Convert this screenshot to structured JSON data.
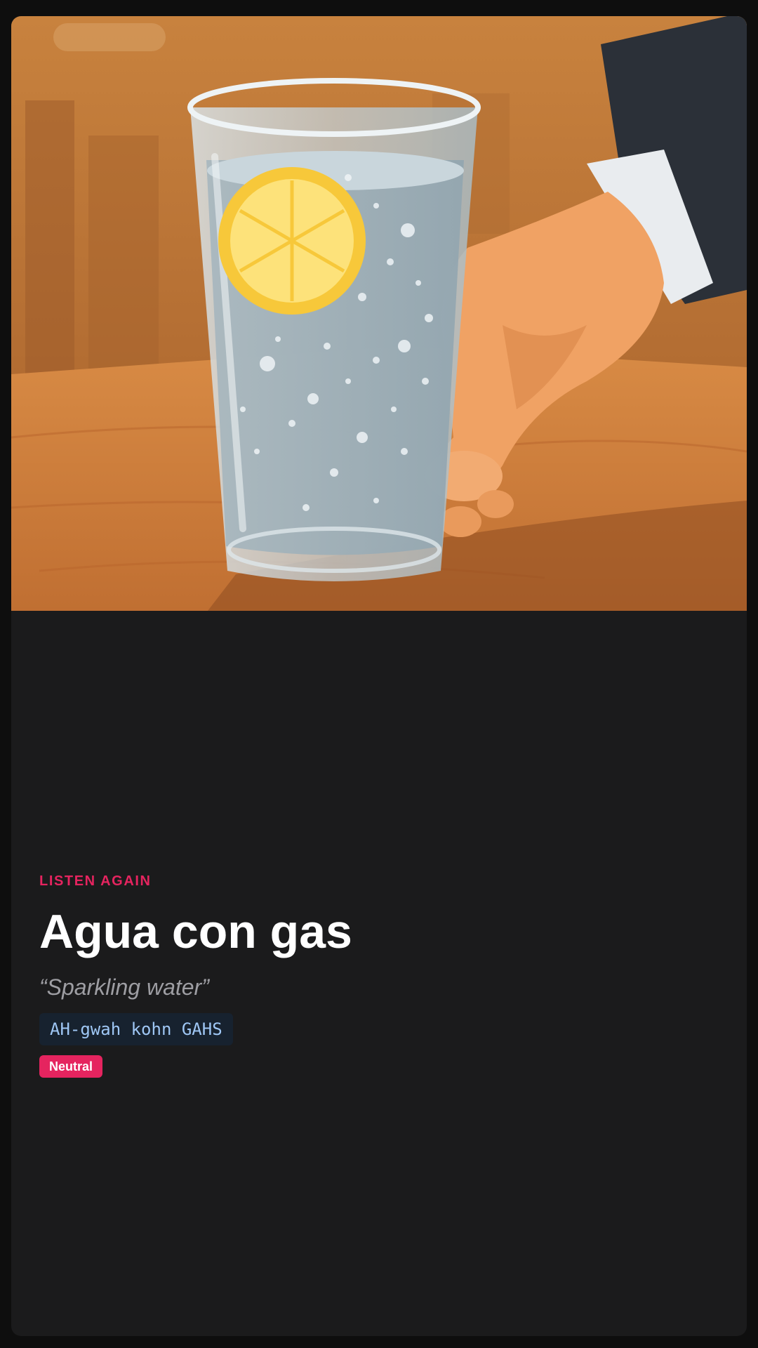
{
  "card": {
    "illustration": {
      "subject": "glass-of-sparkling-water-with-lemon-slice-held-by-hand",
      "colors": {
        "wall": "#b36a2f",
        "table": "#d2833e",
        "water": "#b9c7cf",
        "lemon": "#f7c83a",
        "hand": "#f0a264",
        "sleeve": "#2b3038"
      }
    },
    "eyebrow": "LISTEN AGAIN",
    "title": "Agua con gas",
    "translation": "“Sparkling water”",
    "pronunciation": "AH-gwah kohn GAHS",
    "tag": "Neutral"
  },
  "colors": {
    "accent": "#e5245f",
    "card_background": "#1b1b1c",
    "page_background": "#0e0e0e",
    "pronunciation_text": "#9fc7f5",
    "translation_text": "#9e9ea3"
  }
}
